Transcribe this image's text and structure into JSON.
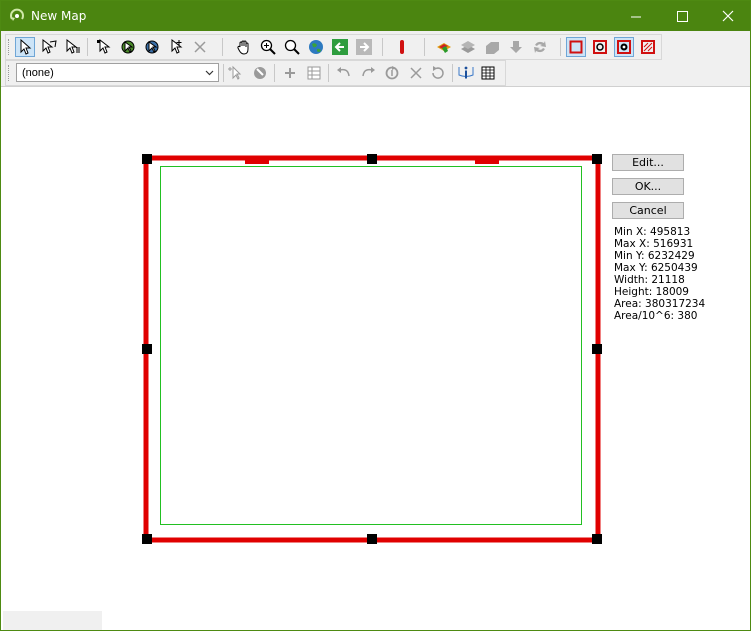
{
  "window": {
    "title": "New Map",
    "controls": [
      "minimize-icon",
      "maximize-icon",
      "close-icon"
    ]
  },
  "toolbar1": {
    "buttons": [
      {
        "name": "select-arrow-icon",
        "pressed": true
      },
      {
        "name": "select-polygon-icon"
      },
      {
        "name": "select-list-icon"
      },
      {
        "name": "edit-vertices-icon"
      },
      {
        "name": "move-features-icon"
      },
      {
        "name": "rotate-features-icon"
      },
      {
        "name": "add-node-icon"
      },
      {
        "name": "delete-icon"
      },
      {
        "name": "pan-hand-icon"
      },
      {
        "name": "zoom-in-icon"
      },
      {
        "name": "zoom-out-icon"
      },
      {
        "name": "globe-icon"
      },
      {
        "name": "back-arrow-icon"
      },
      {
        "name": "forward-arrow-icon"
      },
      {
        "name": "marker-icon"
      },
      {
        "name": "layer-paint-icon"
      },
      {
        "name": "layers-icon"
      },
      {
        "name": "layer-stack-icon"
      },
      {
        "name": "arrow-down-icon"
      },
      {
        "name": "refresh-icon"
      },
      {
        "name": "frame-square-icon",
        "pressed": true
      },
      {
        "name": "frame-circle-icon"
      },
      {
        "name": "frame-gear-icon",
        "pressed": true
      },
      {
        "name": "frame-slash-icon"
      }
    ]
  },
  "toolbar2": {
    "dropdown": {
      "value": "(none)"
    },
    "buttons": [
      "pointer-add-icon",
      "paint-icon",
      "plus-icon",
      "grid-icon",
      "undo-icon",
      "redo-icon",
      "cycle-icon",
      "cancel-x-icon",
      "reset-icon",
      "info-icon",
      "table-icon"
    ]
  },
  "panel": {
    "edit_label": "Edit...",
    "ok_label": "OK...",
    "cancel_label": "Cancel",
    "stats": [
      "Min X: 495813",
      "Max X: 516931",
      "Min Y: 6232429",
      "Max Y: 6250439",
      "Width: 21118",
      "Height: 18009",
      "Area: 380317234",
      "Area/10^6: 380"
    ]
  },
  "colors": {
    "titlebar": "#4b8510",
    "frame": "#e00000",
    "inner_border": "#00c000",
    "handle": "#000000"
  }
}
